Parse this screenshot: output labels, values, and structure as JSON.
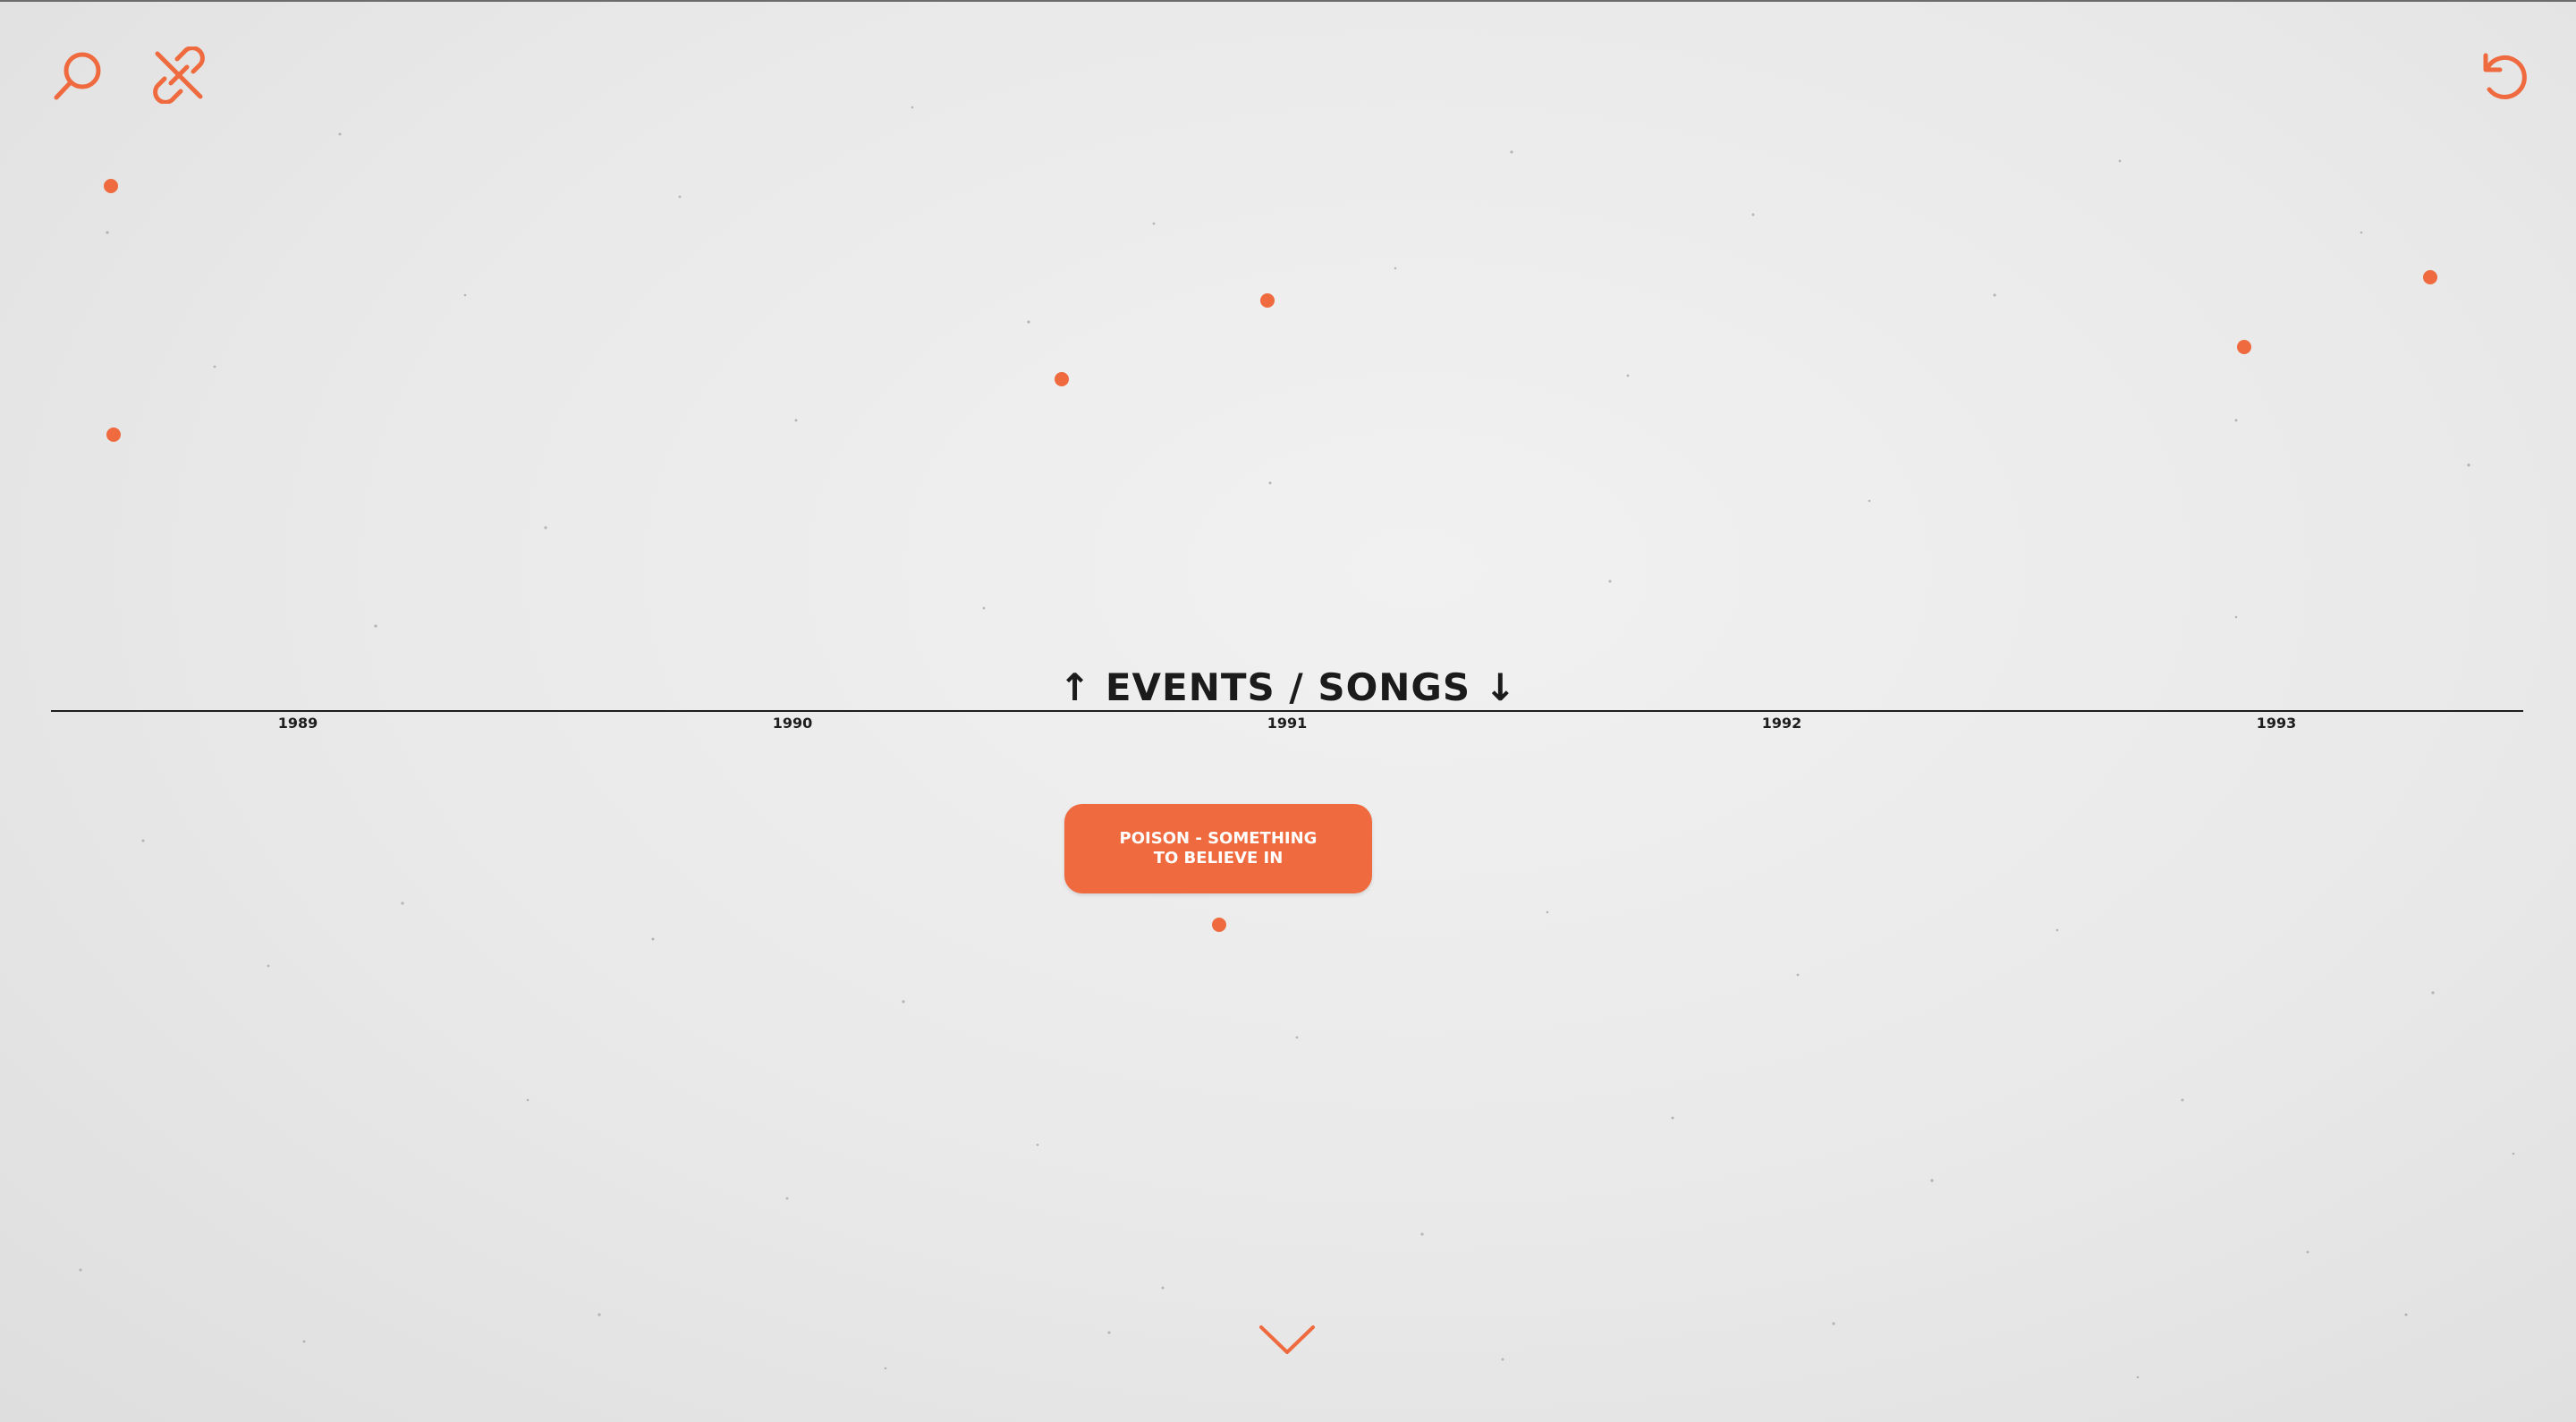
{
  "theme": {
    "accent": "#ef6a3e",
    "text": "#1e1e1e",
    "background": "#ebebeb"
  },
  "toolbar": {
    "search_icon": "search-icon",
    "link_off_icon": "link-off-icon",
    "reset_icon": "undo-icon"
  },
  "timeline": {
    "heading": "↑ EVENTS / SONGS ↓",
    "years": [
      "1989",
      "1990",
      "1991",
      "1992",
      "1993"
    ]
  },
  "song": {
    "label": "POISON - SOMETHING TO BELIEVE IN"
  },
  "scroll": {
    "icon": "chevron-down-icon"
  }
}
